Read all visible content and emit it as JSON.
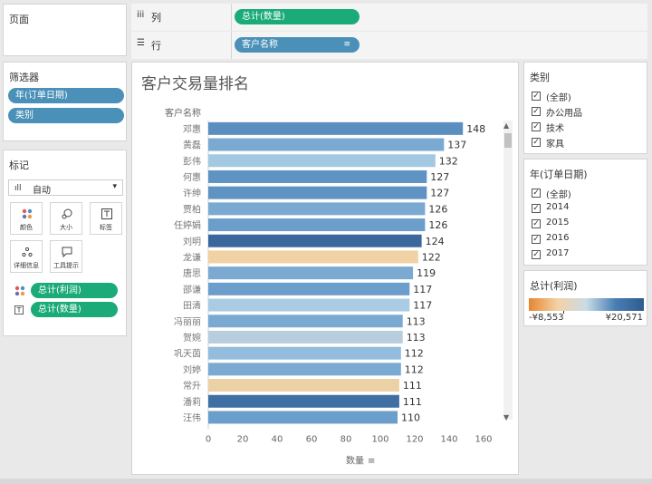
{
  "left": {
    "pages_title": "页面",
    "filters_title": "筛选器",
    "filters": [
      "年(订单日期)",
      "类别"
    ],
    "marks_title": "标记",
    "mark_type": "自动",
    "mark_buttons": [
      "颜色",
      "大小",
      "标签",
      "详细信息",
      "工具提示"
    ],
    "mark_fields": [
      {
        "icon": "color-dots-icon",
        "label": "总计(利润)"
      },
      {
        "icon": "text-icon",
        "label": "总计(数量)"
      }
    ]
  },
  "shelves": {
    "columns_label": "列",
    "columns_pill": "总计(数量)",
    "rows_label": "行",
    "rows_pill": "客户名称"
  },
  "right": {
    "category_title": "类别",
    "category_items": [
      "(全部)",
      "办公用品",
      "技术",
      "家具"
    ],
    "year_title": "年(订单日期)",
    "year_items": [
      "(全部)",
      "2014",
      "2015",
      "2016",
      "2017"
    ],
    "legend_title": "总计(利润)",
    "legend_min": "-¥8,553",
    "legend_max": "¥20,571",
    "legend_colors": [
      "#e8862f",
      "#f3d2a6",
      "#c9dbe6",
      "#4a7fb4",
      "#2d5c8f"
    ]
  },
  "chart_data": {
    "type": "bar",
    "orientation": "horizontal",
    "title": "客户交易量排名",
    "ylabel": "客户名称",
    "xlabel": "数量",
    "xlim": [
      0,
      160
    ],
    "xticks": [
      0,
      20,
      40,
      60,
      80,
      100,
      120,
      140,
      160
    ],
    "categories": [
      "邓惠",
      "黄磊",
      "彭伟",
      "何惠",
      "许绅",
      "贾柏",
      "任婷娟",
      "刘明",
      "龙谦",
      "唐思",
      "邵谦",
      "田清",
      "冯丽丽",
      "贺婉",
      "巩天茵",
      "刘婷",
      "常升",
      "潘莉",
      "汪伟"
    ],
    "values": [
      148,
      137,
      132,
      127,
      127,
      126,
      126,
      124,
      122,
      119,
      117,
      117,
      113,
      113,
      112,
      112,
      111,
      111,
      110
    ],
    "colors": [
      "#5b8fc0",
      "#7aaad2",
      "#a3c8e2",
      "#5f93c3",
      "#5f93c3",
      "#7aaad2",
      "#6c9ecb",
      "#3a689d",
      "#f0d2a4",
      "#7ba9d2",
      "#6c9ecb",
      "#a9cbe3",
      "#7aaad2",
      "#b8cddd",
      "#93bcdd",
      "#7aaad2",
      "#ead1a6",
      "#3f6fa3",
      "#6c9ecb"
    ]
  }
}
